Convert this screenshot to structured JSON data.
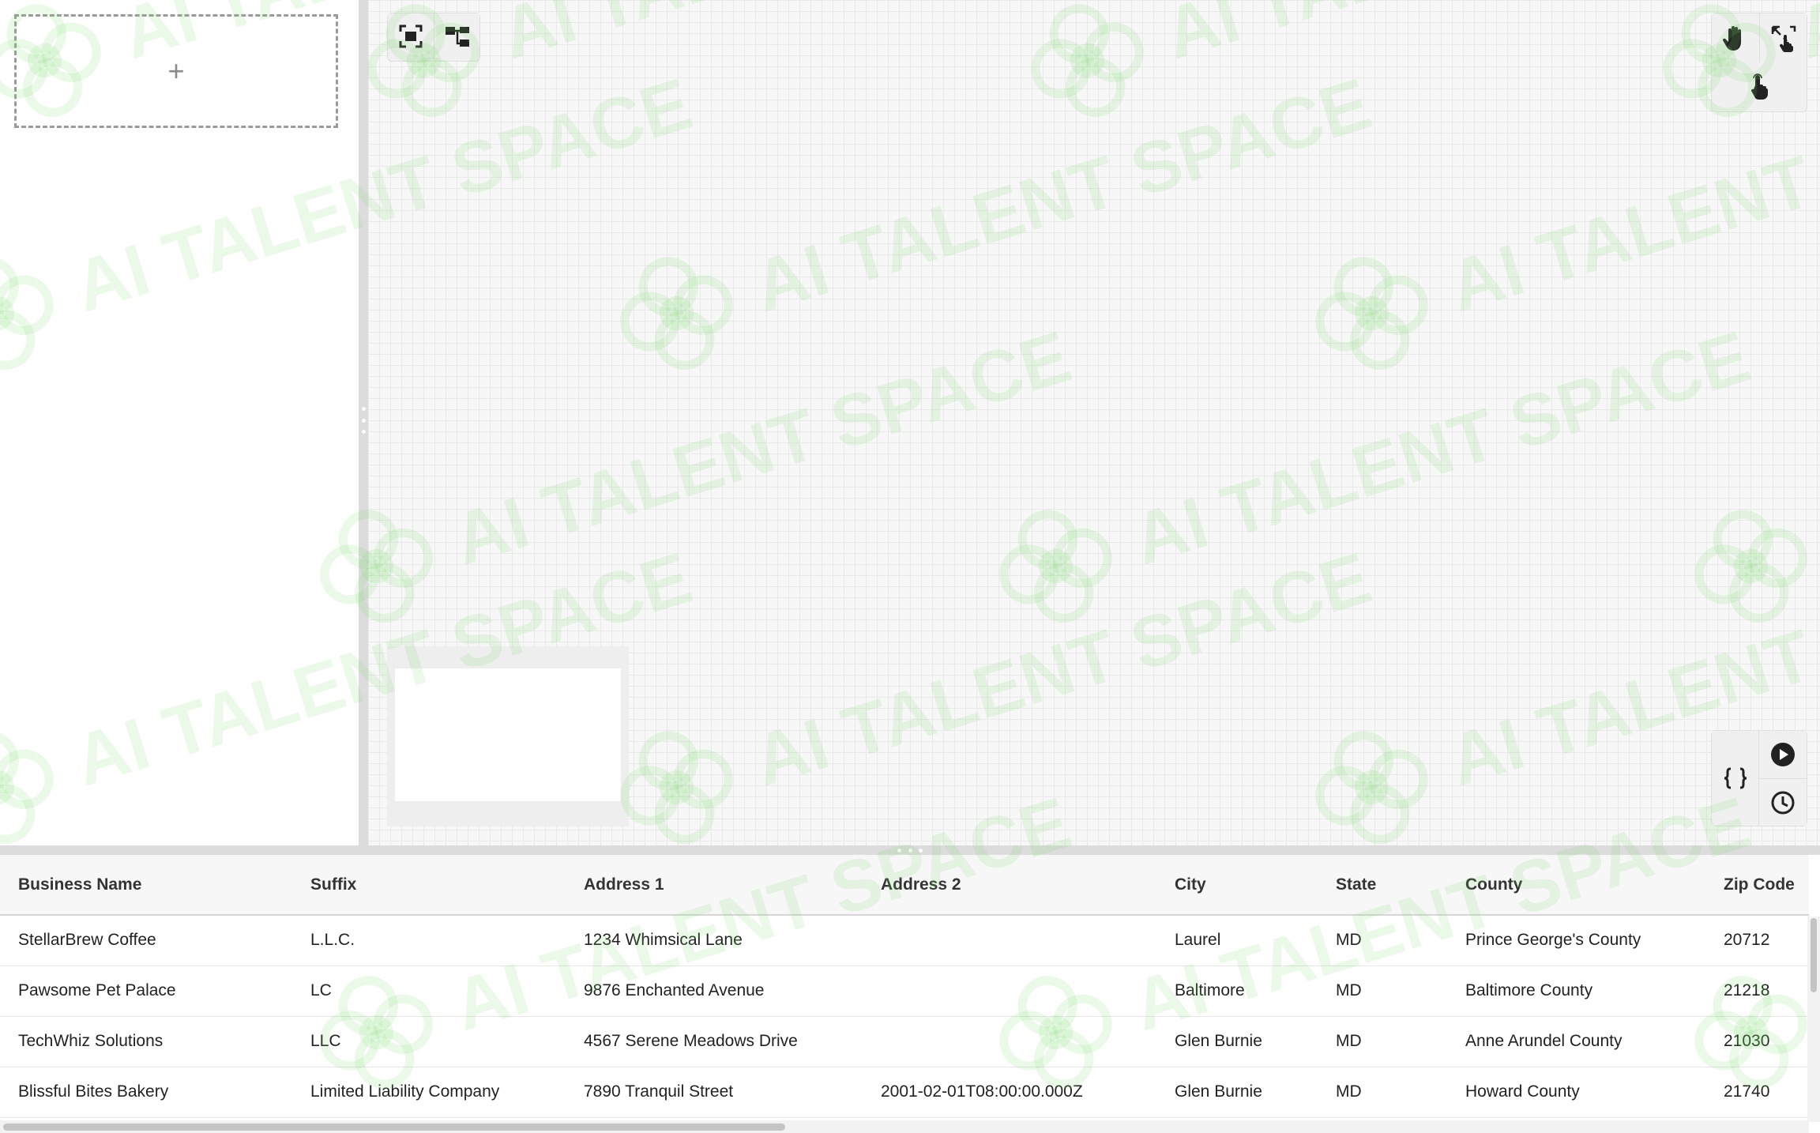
{
  "left_panel": {
    "add_symbol": "+"
  },
  "canvas": {
    "toolbar_top_left": [
      "fit-view-icon",
      "auto-layout-icon"
    ],
    "toolbar_top_right": [
      "hand-pan-icon",
      "expand-cursor-icon",
      "pointer-select-icon"
    ],
    "toolbar_bottom_right": [
      "code-braces-icon",
      "play-icon",
      "history-clock-icon"
    ]
  },
  "watermark": {
    "text": "AI TALENT SPACE"
  },
  "table": {
    "columns": [
      "Business Name",
      "Suffix",
      "Address 1",
      "Address 2",
      "City",
      "State",
      "County",
      "Zip Code"
    ],
    "rows": [
      [
        "StellarBrew Coffee",
        "L.L.C.",
        "1234 Whimsical Lane",
        "",
        "Laurel",
        "MD",
        "Prince George's County",
        "20712"
      ],
      [
        "Pawsome Pet Palace",
        "LC",
        "9876 Enchanted Avenue",
        "",
        "Baltimore",
        "MD",
        "Baltimore County",
        "21218"
      ],
      [
        "TechWhiz Solutions",
        "LLC",
        "4567 Serene Meadows Drive",
        "",
        "Glen Burnie",
        "MD",
        "Anne Arundel County",
        "21030"
      ],
      [
        "Blissful Bites Bakery",
        "Limited Liability Company",
        "7890 Tranquil Street",
        "2001-02-01T08:00:00.000Z",
        "Glen Burnie",
        "MD",
        "Howard County",
        "21740"
      ]
    ]
  },
  "colors": {
    "watermark": "#78d76e",
    "splitter": "#dcdcdc",
    "grid": "#e9e9e9"
  }
}
